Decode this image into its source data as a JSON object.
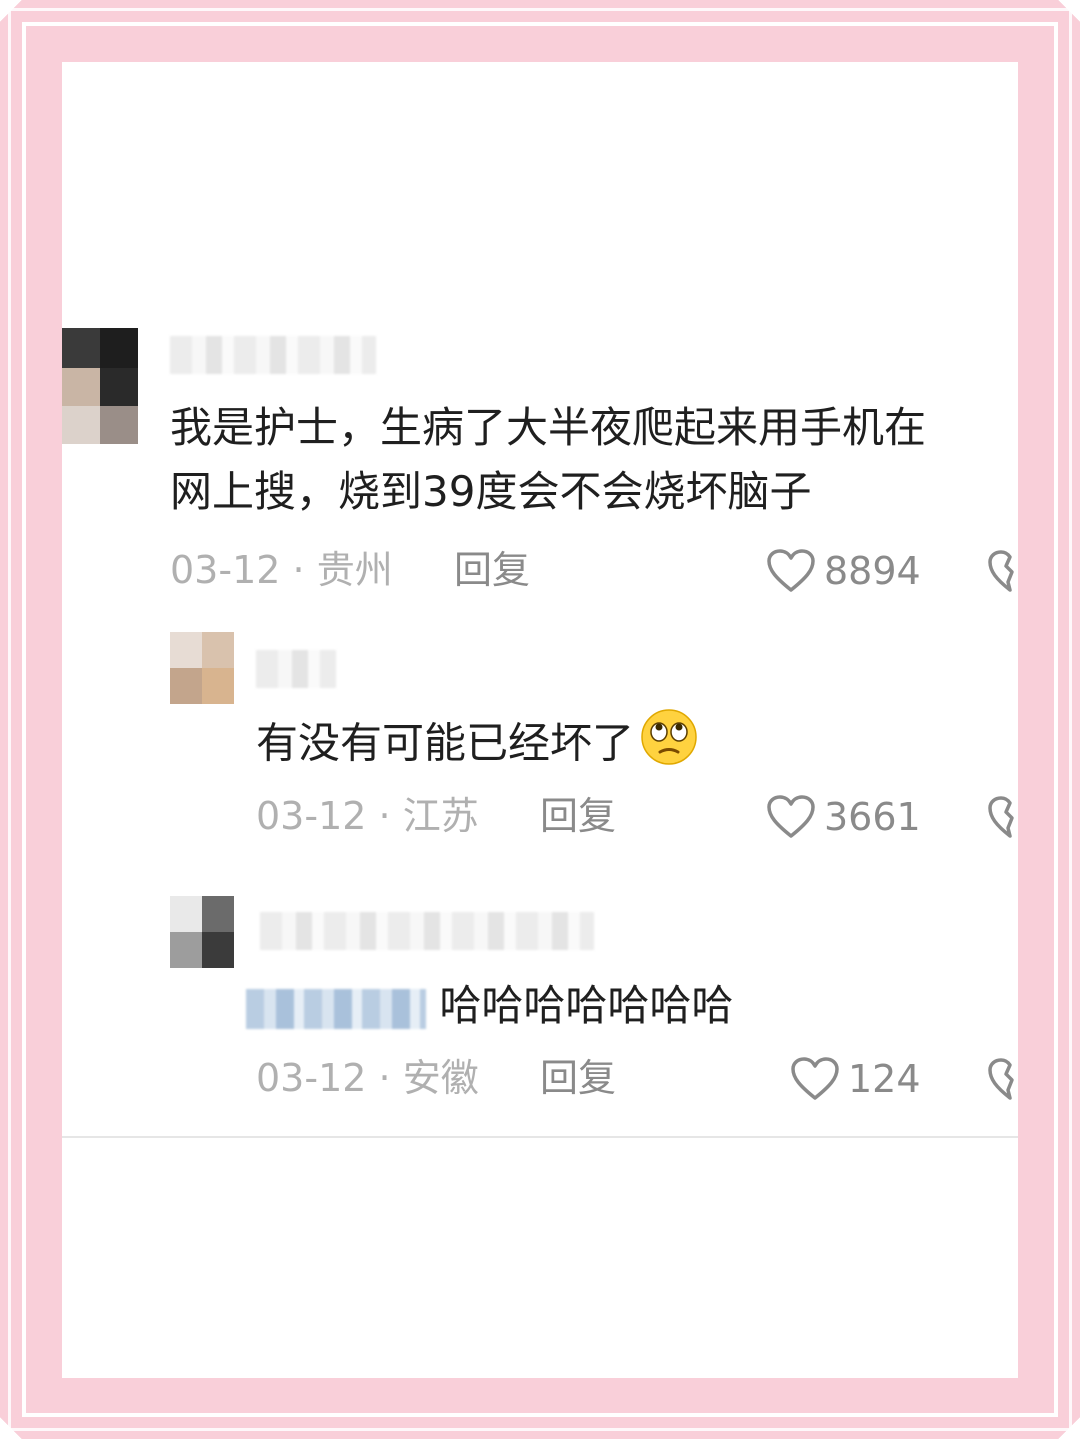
{
  "comments": [
    {
      "text_line1": "我是护士，生病了大半夜爬起来用手机在",
      "text_line2": "网上搜，烧到39度会不会烧坏脑子",
      "date": "03-12",
      "location": "贵州",
      "separator": "·",
      "reply_label": "回复",
      "likes": "8894"
    },
    {
      "text": "有没有可能已经坏了",
      "emoji": "rolling-eyes-emoji",
      "date": "03-12",
      "location": "江苏",
      "separator": "·",
      "reply_label": "回复",
      "likes": "3661"
    },
    {
      "text": "哈哈哈哈哈哈哈",
      "date": "03-12",
      "location": "安徽",
      "separator": "·",
      "reply_label": "回复",
      "likes": "124"
    }
  ],
  "colors": {
    "frame_pink": "#f9cfd9",
    "text": "#1f1f1f",
    "meta": "#b0b0b0",
    "action": "#8a8a8a",
    "mention": "#6b8fc2"
  }
}
